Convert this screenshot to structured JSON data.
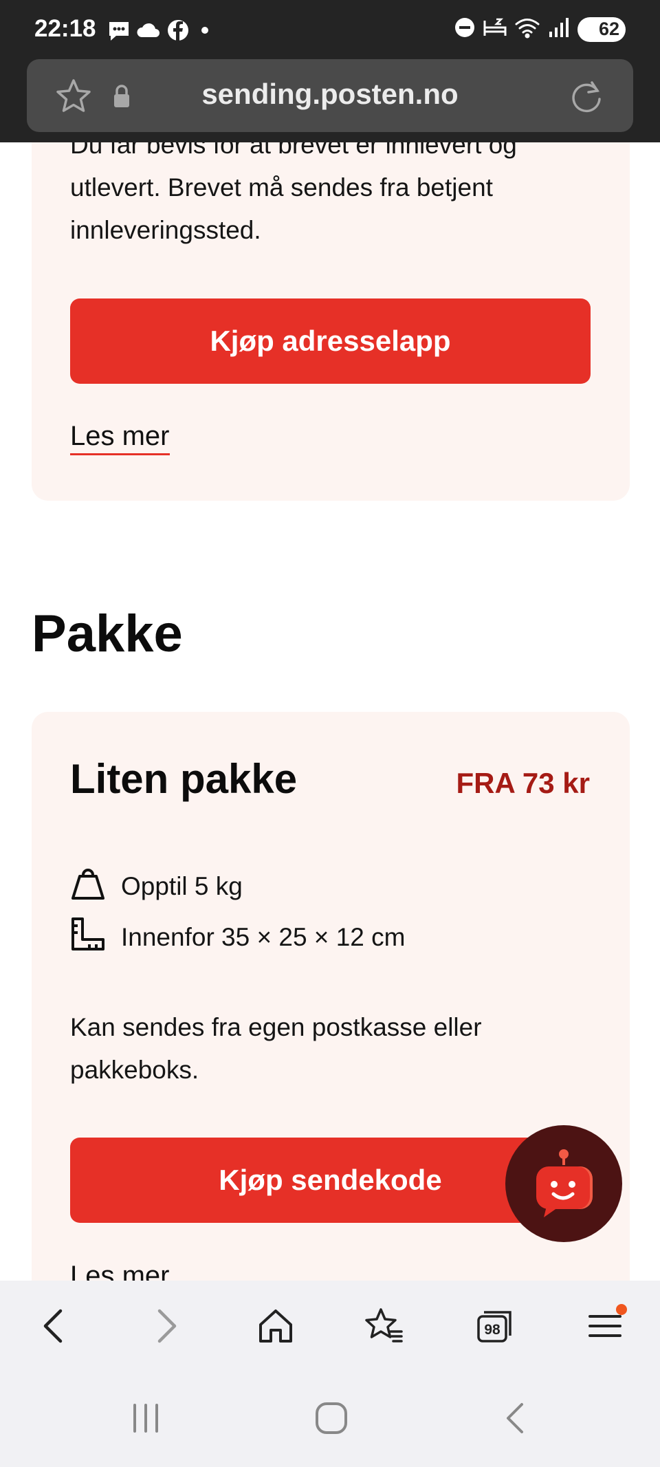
{
  "status_bar": {
    "time": "22:18",
    "battery": "62",
    "notification_icons": [
      "chat-bubble-icon",
      "cloud-icon",
      "facebook-icon",
      "dot-icon"
    ],
    "system_icons": [
      "do-not-disturb-icon",
      "sleep-icon",
      "wifi-icon",
      "signal-icon"
    ]
  },
  "browser": {
    "url": "sending.posten.no"
  },
  "letter_card": {
    "description_partial": "Du får bevis for at brevet er innlevert og",
    "description_rest": "utlevert. Brevet må sendes fra betjent innleveringssted.",
    "button_label": "Kjøp adresselapp",
    "link_label": "Les mer"
  },
  "section": {
    "heading": "Pakke"
  },
  "package_card": {
    "title": "Liten pakke",
    "price": "FRA 73 kr",
    "weight": "Opptil 5 kg",
    "size": "Innenfor 35 × 25 × 12 cm",
    "description": "Kan sendes fra egen postkasse eller pakkeboks.",
    "button_label": "Kjøp sendekode",
    "link_label": "Les mer"
  },
  "colors": {
    "accent": "#e63027",
    "price": "#a51b15",
    "card_bg": "#fdf4f1",
    "chat_bg": "#4c1313",
    "toolbar_bg": "#f1f1f4"
  },
  "toolbar": {
    "tab_count": "98",
    "icons": [
      "back-icon",
      "forward-icon",
      "home-icon",
      "bookmarks-icon",
      "tabs-icon",
      "menu-icon"
    ]
  },
  "navigation_bar": {
    "icons": [
      "recents-icon",
      "home-button-icon",
      "back-nav-icon"
    ]
  }
}
